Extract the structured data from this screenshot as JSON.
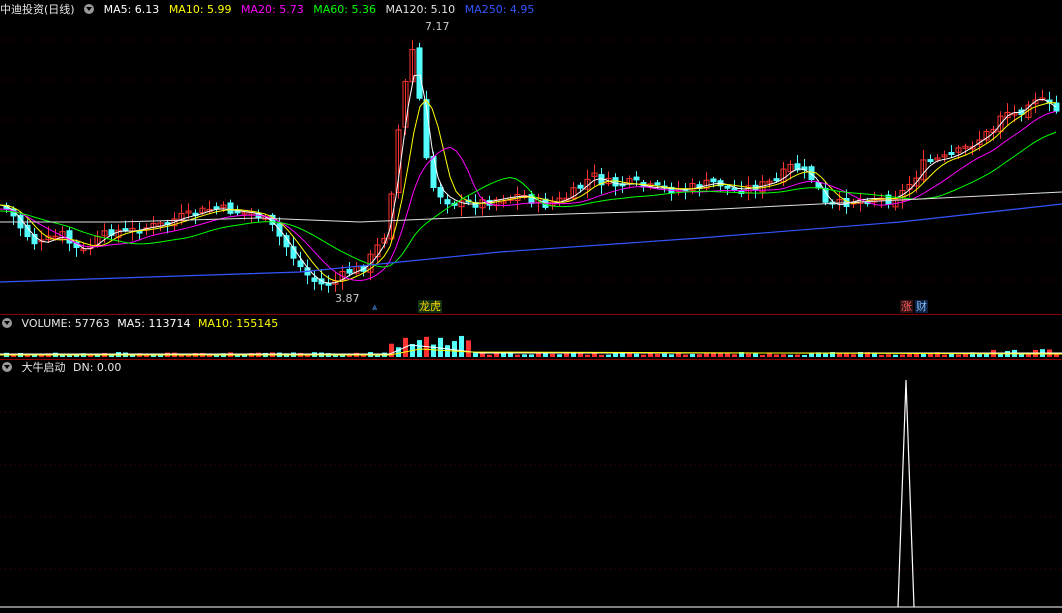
{
  "main": {
    "title": "中迪投资(日线)",
    "ma": [
      {
        "label": "MA5: 6.13",
        "color": "#ffffff"
      },
      {
        "label": "MA10: 5.99",
        "color": "#ffff00"
      },
      {
        "label": "MA20: 5.73",
        "color": "#ff00ff"
      },
      {
        "label": "MA60: 5.36",
        "color": "#00ff00"
      },
      {
        "label": "MA120: 5.10",
        "color": "#e0e0e0"
      },
      {
        "label": "MA250: 4.95",
        "color": "#3355ff"
      }
    ],
    "high_label": "7.17",
    "low_label": "3.87",
    "tag_longhu": "龙虎",
    "tag_zhang": "涨",
    "tag_cai": "财"
  },
  "volume": {
    "title": "VOLUME: 57763",
    "ma5": "MA5: 113714",
    "ma10": "MA10: 155145"
  },
  "indicator": {
    "title": "大牛启动",
    "dn": "DN: 0.00"
  },
  "colors": {
    "up": "#ff3232",
    "down": "#54ffff",
    "grid": "#5a0000",
    "separator": "#8b0000"
  }
}
